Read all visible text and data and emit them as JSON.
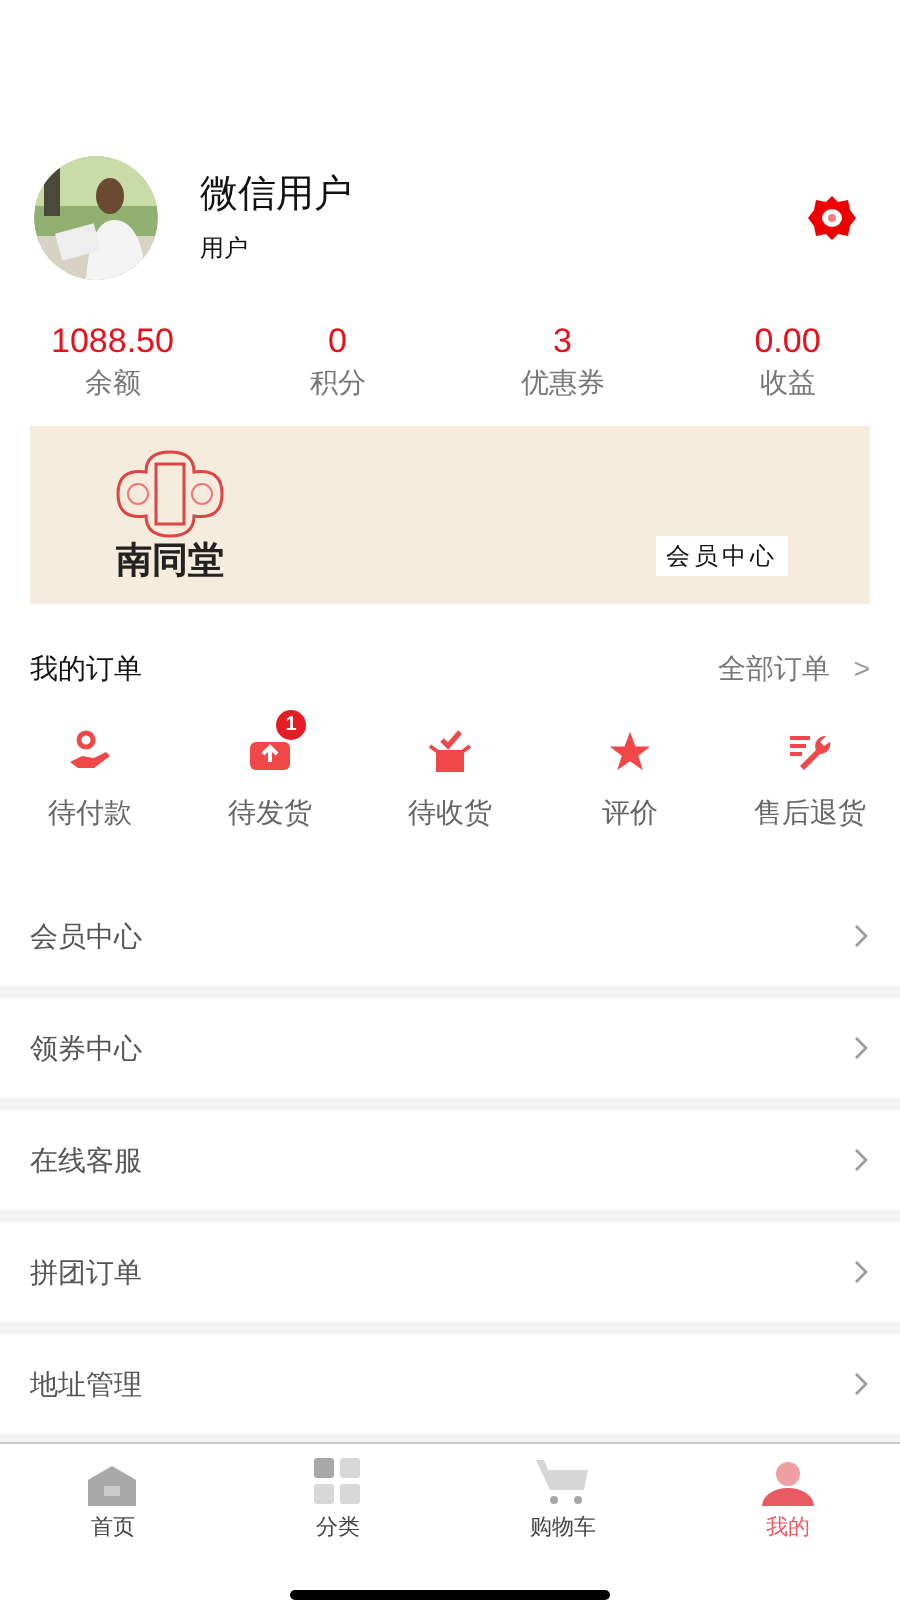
{
  "profile": {
    "name": "微信用户",
    "role": "用户"
  },
  "stats": [
    {
      "value": "1088.50",
      "label": "余额"
    },
    {
      "value": "0",
      "label": "积分"
    },
    {
      "value": "3",
      "label": "优惠券"
    },
    {
      "value": "0.00",
      "label": "收益"
    }
  ],
  "banner": {
    "brand": "南同堂",
    "caption": "会员中心"
  },
  "orders": {
    "title": "我的订单",
    "all_link": "全部订单",
    "chevron": ">",
    "items": [
      {
        "kind": "pay",
        "label": "待付款"
      },
      {
        "kind": "ship",
        "label": "待发货",
        "badge": "1"
      },
      {
        "kind": "receive",
        "label": "待收货"
      },
      {
        "kind": "review",
        "label": "评价"
      },
      {
        "kind": "refund",
        "label": "售后退货"
      }
    ]
  },
  "menu": [
    {
      "label": "会员中心"
    },
    {
      "label": "领券中心"
    },
    {
      "label": "在线客服"
    },
    {
      "label": "拼团订单"
    },
    {
      "label": "地址管理"
    }
  ],
  "tab_bar": [
    {
      "kind": "home",
      "label": "首页",
      "selected": false
    },
    {
      "kind": "category",
      "label": "分类",
      "selected": false
    },
    {
      "kind": "cart",
      "label": "购物车",
      "selected": false
    },
    {
      "kind": "me",
      "label": "我的",
      "selected": true
    }
  ]
}
